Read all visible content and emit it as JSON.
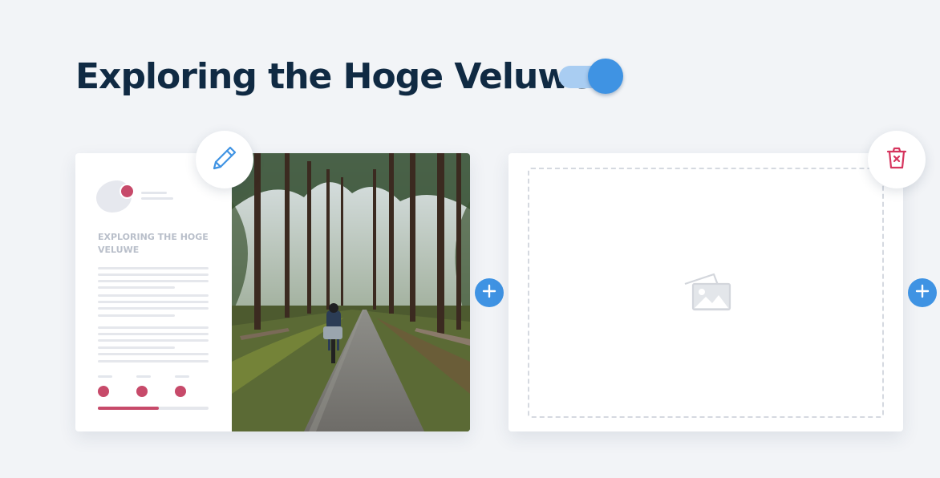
{
  "page": {
    "title": "Exploring the Hoge Veluwe"
  },
  "toggle": {
    "on": true,
    "accent": "#3f93e3"
  },
  "card_left": {
    "doc_title": "EXPLORING THE HOGE VELUWE",
    "progress": 0.55,
    "photo_alt": "Cyclist riding along a paved path through a pine forest"
  },
  "card_right": {
    "placeholder": "image-placeholder-icon"
  },
  "icons": {
    "edit": "pencil-icon",
    "delete": "trash-icon",
    "add": "plus-icon"
  },
  "colors": {
    "title": "#102a43",
    "accent": "#3f93e3",
    "doc_accent": "#c74a6a",
    "delete": "#d6355e",
    "background": "#f2f4f7"
  }
}
